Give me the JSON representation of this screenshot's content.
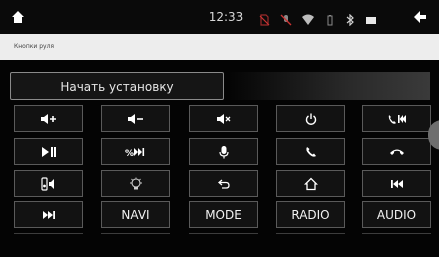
{
  "status_bar": {
    "time": "12:33",
    "icons": [
      "home-icon",
      "sim-off-icon",
      "mic-off-icon",
      "wifi-icon",
      "bluetooth-icon",
      "battery-icon",
      "back-arrow-icon"
    ]
  },
  "header": {
    "title": "Кнопки руля"
  },
  "install_button": {
    "label": "Начать установку"
  },
  "keys": {
    "row1": [
      "volume-up-icon",
      "volume-down-icon",
      "mute-icon",
      "power-icon",
      "phone-previous-icon"
    ],
    "row2": [
      "play-pause-icon",
      "mode-next-icon",
      "voice-icon",
      "phone-answer-icon",
      "phone-hangup-icon"
    ],
    "row3": [
      "speaker-volume-icon",
      "lightbulb-icon",
      "return-icon",
      "home-outline-icon",
      "previous-track-icon"
    ],
    "row4": {
      "next_icon": "next-track-icon",
      "navi": "NAVI",
      "mode": "MODE",
      "radio": "RADIO",
      "audio": "AUDIO"
    }
  },
  "colors": {
    "background": "#000000",
    "key_border": "#5a5a5a",
    "title_bar": "#ededed",
    "text": "#f0f0f0"
  }
}
